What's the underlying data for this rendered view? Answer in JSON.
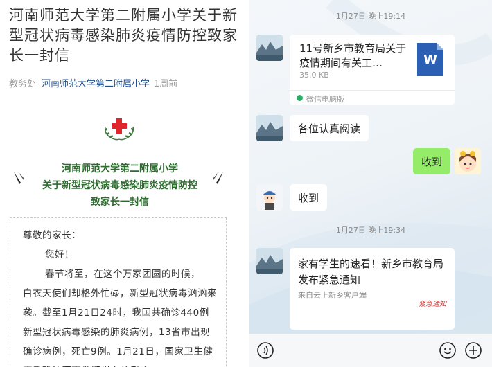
{
  "article": {
    "title": "河南师范大学第二附属小学关于新型冠状病毒感染肺炎疫情防控致家长一封信",
    "meta": {
      "dept": "教务处",
      "author": "河南师范大学第二附属小学",
      "time": "1周前"
    },
    "banner": {
      "line1": "河南师范大学第二附属小学",
      "line2": "关于新型冠状病毒感染肺炎疫情防控",
      "line3": "致家长一封信"
    },
    "letter": {
      "salutation": "尊敬的家长：",
      "greeting": "您好！",
      "body_line1": "春节将至，在这个万家团圆的时候，",
      "body_rest": "白衣天使们却格外忙碌，新型冠状病毒汹汹来袭。截至1月21日24时，我国共确诊440例新型冠状病毒感染的肺炎病例，13省市出现确诊病例，死亡9例。1月21日，国家卫生健康委确认河南省郑州市首例输"
    }
  },
  "chat": {
    "timestamp1": "1月27日 晚上19:14",
    "file_msg": {
      "title": "11号新乡市教育局关于疫情期间有关工…",
      "size": "35.0 KB",
      "source": "微信电脑版",
      "icon_letter": "W"
    },
    "msg_read": "各位认真阅读",
    "msg_received_me": "收到",
    "msg_received_other": "收到",
    "timestamp2": "1月27日 晚上19:34",
    "link_msg": {
      "title": "家有学生的速看！新乡市教育局发布紧急通知",
      "source": "来自云上新乡客户端",
      "thumb_text": "紧急通知"
    }
  },
  "colors": {
    "cross_red": "#e0262a",
    "banner_green": "#2e6b2f",
    "bubble_green": "#95ec69",
    "word_blue": "#2b5fb4",
    "link_blue": "#1f4e8c"
  }
}
